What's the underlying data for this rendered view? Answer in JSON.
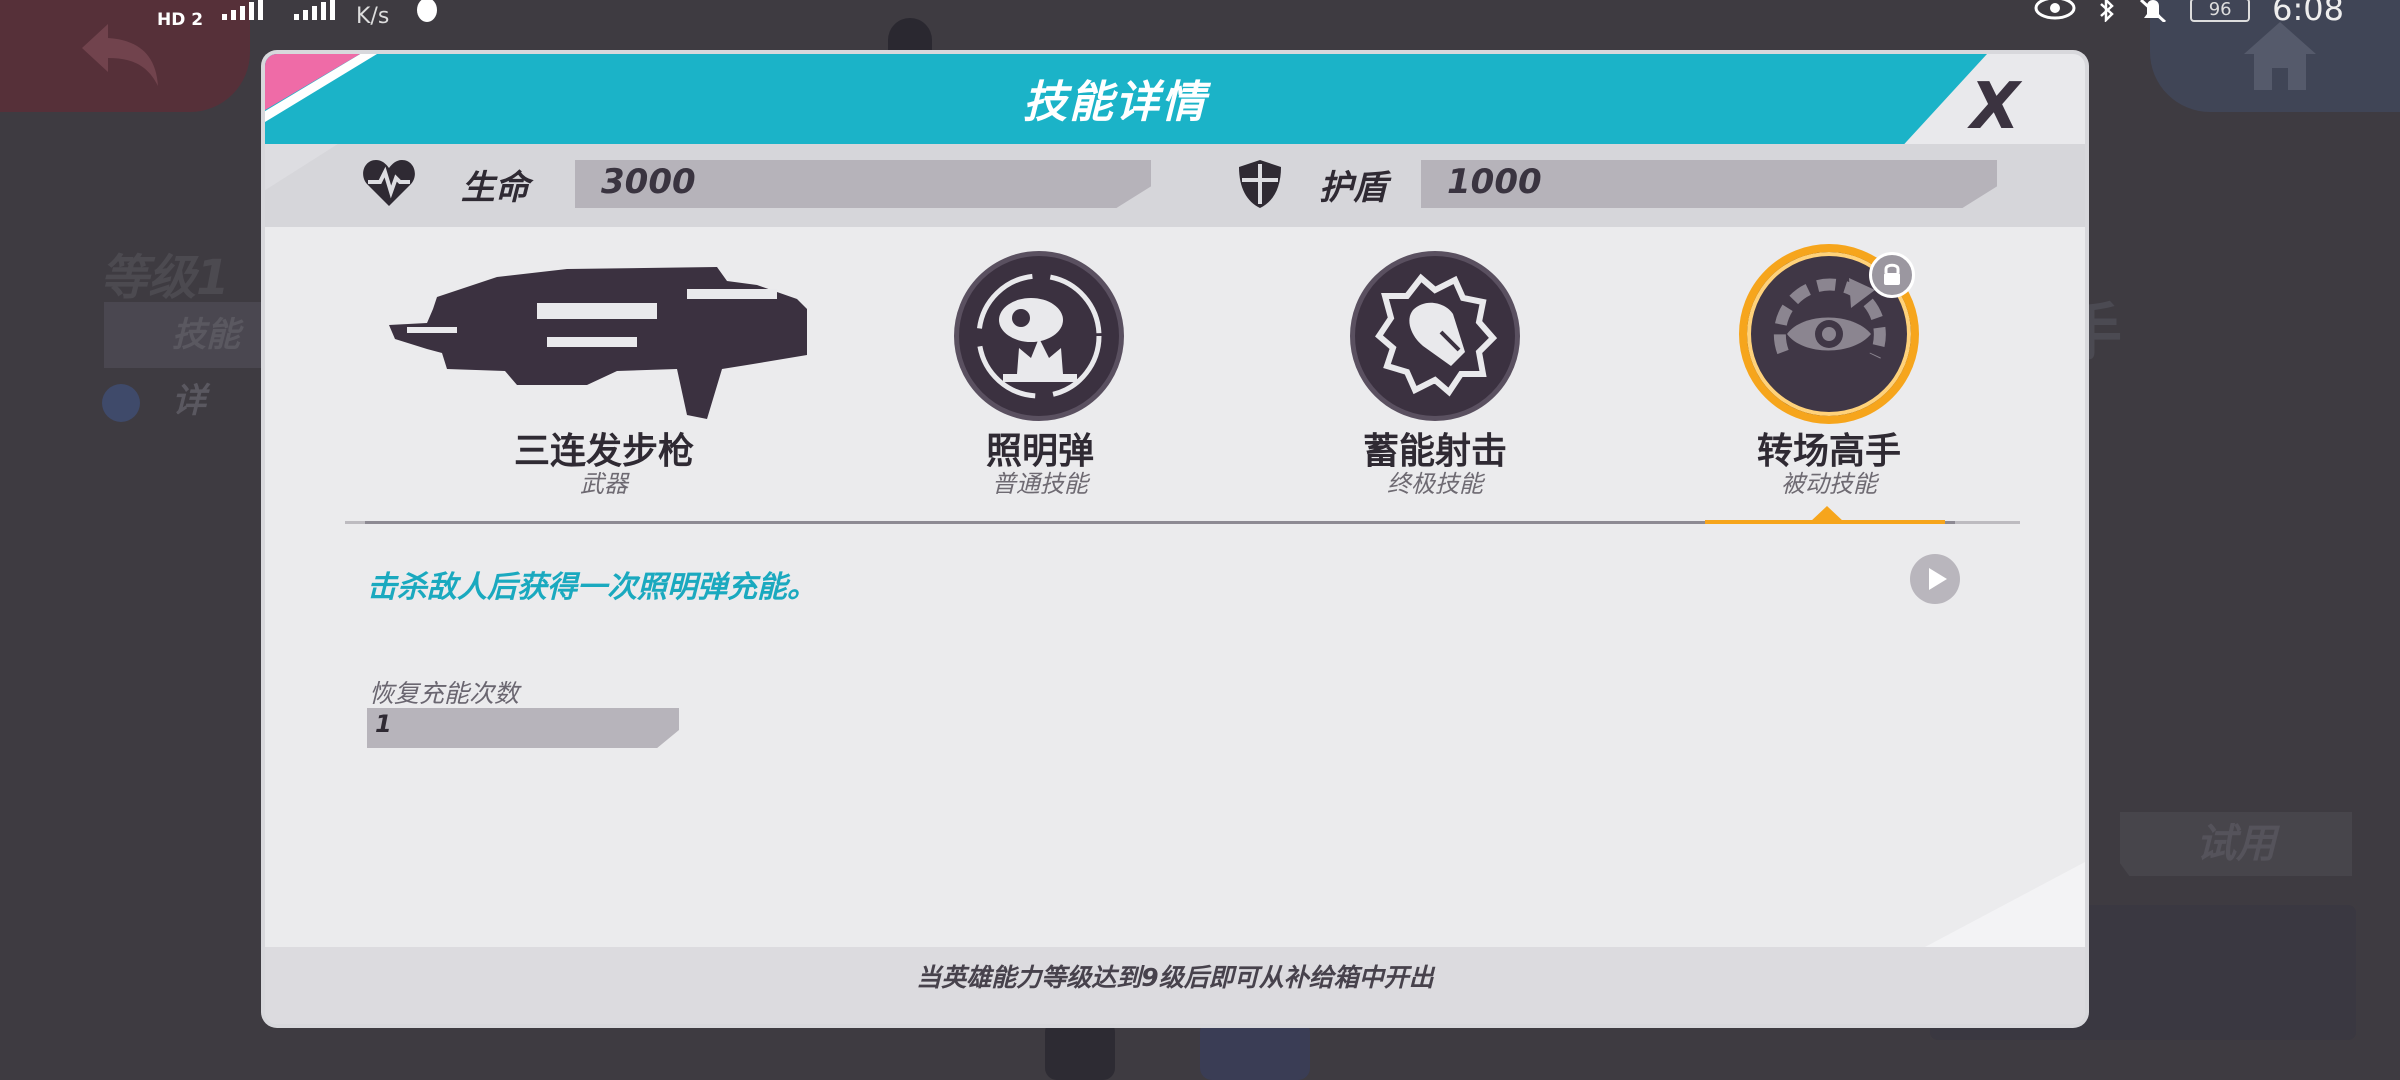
{
  "status_bar": {
    "hd_label": "HD",
    "sim_slot": "2",
    "net_speed": "K/s",
    "battery": "96",
    "time": "6:08"
  },
  "background": {
    "level_text": "等级1",
    "skill_tag": "技能详",
    "right_char": "手",
    "try_label": "试用"
  },
  "dialog": {
    "title": "技能详情",
    "close_label": "X",
    "stats": {
      "hp_label": "生命",
      "hp_value": "3000",
      "shield_label": "护盾",
      "shield_value": "1000"
    },
    "skills": [
      {
        "name": "三连发步枪",
        "type": "武器",
        "icon": "rifle-icon"
      },
      {
        "name": "照明弹",
        "type": "普通技能",
        "icon": "flare-icon"
      },
      {
        "name": "蓄能射击",
        "type": "终极技能",
        "icon": "charged-shot-icon"
      },
      {
        "name": "转场高手",
        "type": "被动技能",
        "icon": "eye-cycle-icon",
        "selected": true,
        "locked": true
      }
    ],
    "description": "击杀敌人后获得一次照明弹充能。",
    "attribute": {
      "label": "恢复充能次数",
      "value": "1"
    },
    "footer": "当英雄能力等级达到9级后即可从补给箱中开出"
  },
  "colors": {
    "accent_cyan": "#1bb3c8",
    "accent_pink": "#ef6ba7",
    "selected_orange": "#f6a51c",
    "icon_dark": "#3b3140"
  }
}
